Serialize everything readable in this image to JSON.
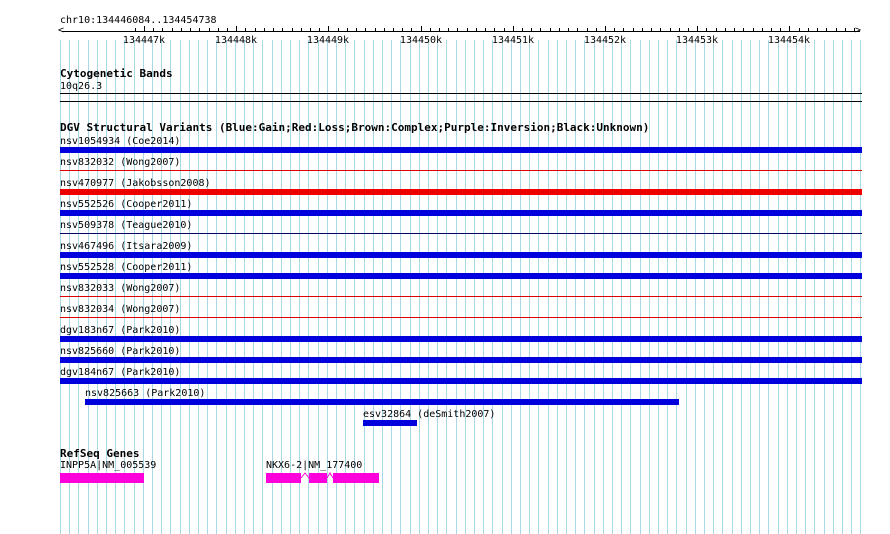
{
  "region": {
    "label": "chr10:134446084..134454738",
    "tick_labels": [
      "134447k",
      "134448k",
      "134449k",
      "134450k",
      "134451k",
      "134452k",
      "134453k",
      "134454k"
    ]
  },
  "cytoband": {
    "title": "Cytogenetic Bands",
    "band": "10q26.3"
  },
  "dgv": {
    "title": "DGV Structural Variants (Blue:Gain;Red:Loss;Brown:Complex;Purple:Inversion;Black:Unknown)",
    "variants": [
      {
        "label": "nsv1054934 (Coe2014)",
        "color": "#0000dd"
      },
      {
        "label": "nsv832032 (Wong2007)",
        "color": "#dd0000"
      },
      {
        "label": "nsv470977 (Jakobsson2008)",
        "color": "#ee0000"
      },
      {
        "label": "nsv552526 (Cooper2011)",
        "color": "#0000dd"
      },
      {
        "label": "nsv509378 (Teague2010)",
        "color": "#000066"
      },
      {
        "label": "nsv467496 (Itsara2009)",
        "color": "#0000dd"
      },
      {
        "label": "nsv552528 (Cooper2011)",
        "color": "#0000dd"
      },
      {
        "label": "nsv832033 (Wong2007)",
        "color": "#dd0000"
      },
      {
        "label": "nsv832034 (Wong2007)",
        "color": "#dd0000"
      },
      {
        "label": "dgv183n67 (Park2010)",
        "color": "#0000dd"
      },
      {
        "label": "nsv825660 (Park2010)",
        "color": "#0000dd"
      },
      {
        "label": "dgv184n67 (Park2010)",
        "color": "#0000dd"
      },
      {
        "label": "nsv825663 (Park2010)",
        "color": "#0000dd"
      },
      {
        "label": "esv32864 (deSmith2007)",
        "color": "#0000dd"
      }
    ]
  },
  "refseq": {
    "title": "RefSeq Genes",
    "genes": [
      {
        "label": "INPP5A|NM_005539",
        "color": "#ff00dd"
      },
      {
        "label": "NKX6-2|NM_177400",
        "color": "#ff00dd"
      }
    ]
  },
  "colors": {
    "grid": "#a8d8e8",
    "axis": "#000000"
  }
}
